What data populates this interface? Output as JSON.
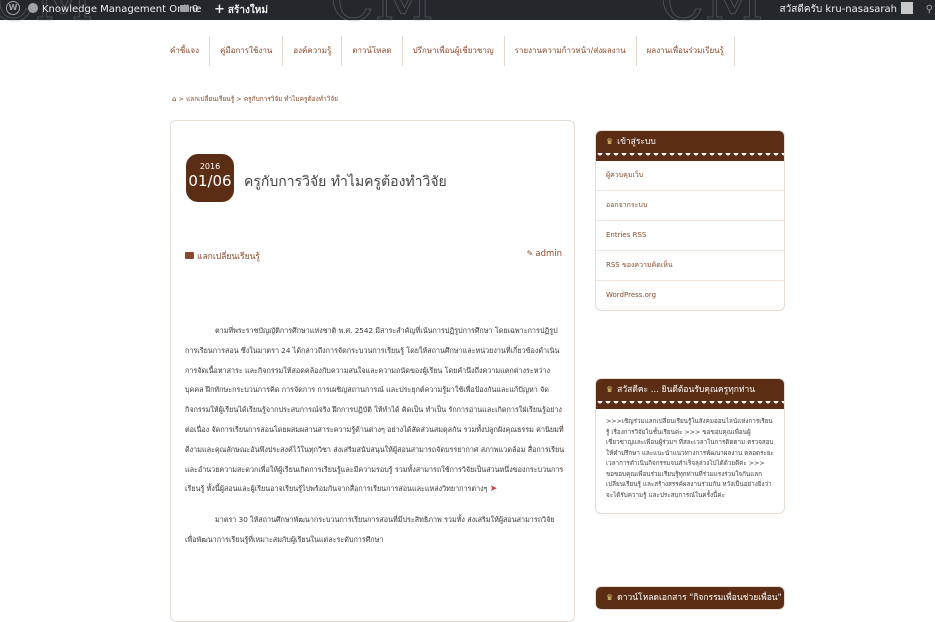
{
  "admin_bar": {
    "site_name": "Knowledge Management Online",
    "comments_count": "0",
    "new_label": "สร้างใหม่",
    "greeting": "สวัสดีครับ kru-nasasarah"
  },
  "menu": {
    "items": [
      "คำชี้แจง",
      "คู่มือการใช้งาน",
      "องค์ความรู้",
      "ดาวน์โหลด",
      "ปรึกษาเพื่อนผู้เชี่ยวชาญ",
      "รายงานความก้าวหน้า/ส่งผลงาน",
      "ผลงานเพื่อนร่วมเรียนรู้"
    ]
  },
  "breadcrumb": {
    "separator": ">",
    "category": "แลกเปลี่ยนเรียนรู้",
    "current": "ครูกับการวิจัย ทำไมครูต้องทำวิจัย"
  },
  "post": {
    "date_year": "2016",
    "date_md": "01/06",
    "title": "ครูกับการวิจัย ทำไมครูต้องทำวิจัย",
    "category": "แลกเปลี่ยนเรียนรู้",
    "author": "admin",
    "paragraph1": "ตามที่พระราชบัญญัติการศึกษาแห่งชาติ พ.ศ. 2542 มีสาระสำคัญที่เน้นการปฏิรูปการศึกษา โดยเฉพาะการปฏิรูปการเรียนการสอน ซึ่งในมาตรา 24 ได้กล่าวถึงการจัดกระบวนการเรียนรู้ โดยให้สถานศึกษาและหน่วยงานที่เกี่ยวข้องดำเนินการจัดเนื้อหาสาระ และกิจกรรมให้สอดคล้องกับความสนใจและความถนัดของผู้เรียน โดยคำนึงถึงความแตกต่างระหว่างบุคคล ฝึกทักษะกระบวนการคิด การจัดการ การเผชิญสถานการณ์ และประยุกต์ความรู้มาใช้เพื่อป้องกันและแก้ปัญหา จัดกิจกรรมให้ผู้เรียนได้เรียนรู้จากประสบการณ์จริง ฝึกการปฏิบัติ ให้ทำได้ คิดเป็น ทำเป็น รักการอ่านและเกิดการใฝ่เรียนรู้อย่างต่อเนื่อง จัดการเรียนการสอนโดยผสมผสานสาระความรู้ด้านต่างๆ อย่างได้สัดส่วนสมดุลกัน รวมทั้งปลูกฝังคุณธรรม ค่านิยมที่ดีงามและคุณลักษณะอันพึงประสงค์ไว้ในทุกวิชา ส่งเสริมสนับสนุนให้ผู้สอนสามารถจัดบรรยากาศ สภาพแวดล้อม สื่อการเรียน และอำนวยความสะดวกเพื่อให้ผู้เรียนเกิดการเรียนรู้และมีความรอบรู้ รวมทั้งสามารถใช้การวิจัยเป็นส่วนหนึ่งของกระบวนการเรียนรู้ ทั้งนี้ผู้สอนและผู้เรียนอาจเรียนรู้ไปพร้อมกันจากสื่อการเรียนการสอนและแหล่งวิทยาการต่างๆ",
    "paragraph2": "มาตรา 30 ให้สถานศึกษาพัฒนากระบวนการเรียนการสอนที่มีประสิทธิภาพ รวมทั้ง ส่งเสริมให้ผู้สอนสามารถวิจัยเพื่อพัฒนาการเรียนรู้ที่เหมาะสมกับผู้เรียนในแต่ละระดับการศึกษา"
  },
  "sidebar": {
    "login_widget": {
      "title": "เข้าสู่ระบบ",
      "links": [
        "ผู้ควบคุมเว็บ",
        "ออกจากระบบ",
        "Entries RSS",
        "RSS ของความคิดเห็น",
        "WordPress.org"
      ]
    },
    "welcome_widget": {
      "title": "สวัสดีคะ ... ยินดีต้อนรับคุณครูทุกท่าน",
      "text": ">>>เชิญร่วมแลกเปลี่ยนเรียนรู้ในสังคมออนไลน์แห่งการเรียนรู้ เรื่องการวิจัยในชั้นเรียนค่ะ >>> ขอขอบคุณเพื่อนผู้เชี่ยวชาญและเพื่อนผู้ร่วมฯ ที่สละเวลาในการติดตาม ตรวจสอบ ให้คำปรึกษา และแนะนำแนวทางการพัฒนาผลงาน ตลอดระยะเวลาการดำเนินกิจกรรมจนสำเร็จลุล่วงไปได้ด้วยดีค่ะ >>> ขอขอบคุณเพื่อนร่วมเรียนรู้ทุกท่านที่ร่วมแรงร่วมใจกันแลกเปลี่ยนเรียนรู้ และสร้างสรรค์ผลงานร่วมกัน หวังเป็นอย่างยิ่งว่าจะได้รับความรู้ และประสบการณ์ในครั้งนี้ค่ะ"
    },
    "third_widget": {
      "title": "ดาวน์โหลดเอกสาร \"กิจกรรมเพื่อนช่วยเพื่อน\""
    }
  },
  "colors": {
    "accent_brown": "#5a2d14",
    "link_brown": "#8a4b2c",
    "adminbar_bg": "#23282d"
  }
}
